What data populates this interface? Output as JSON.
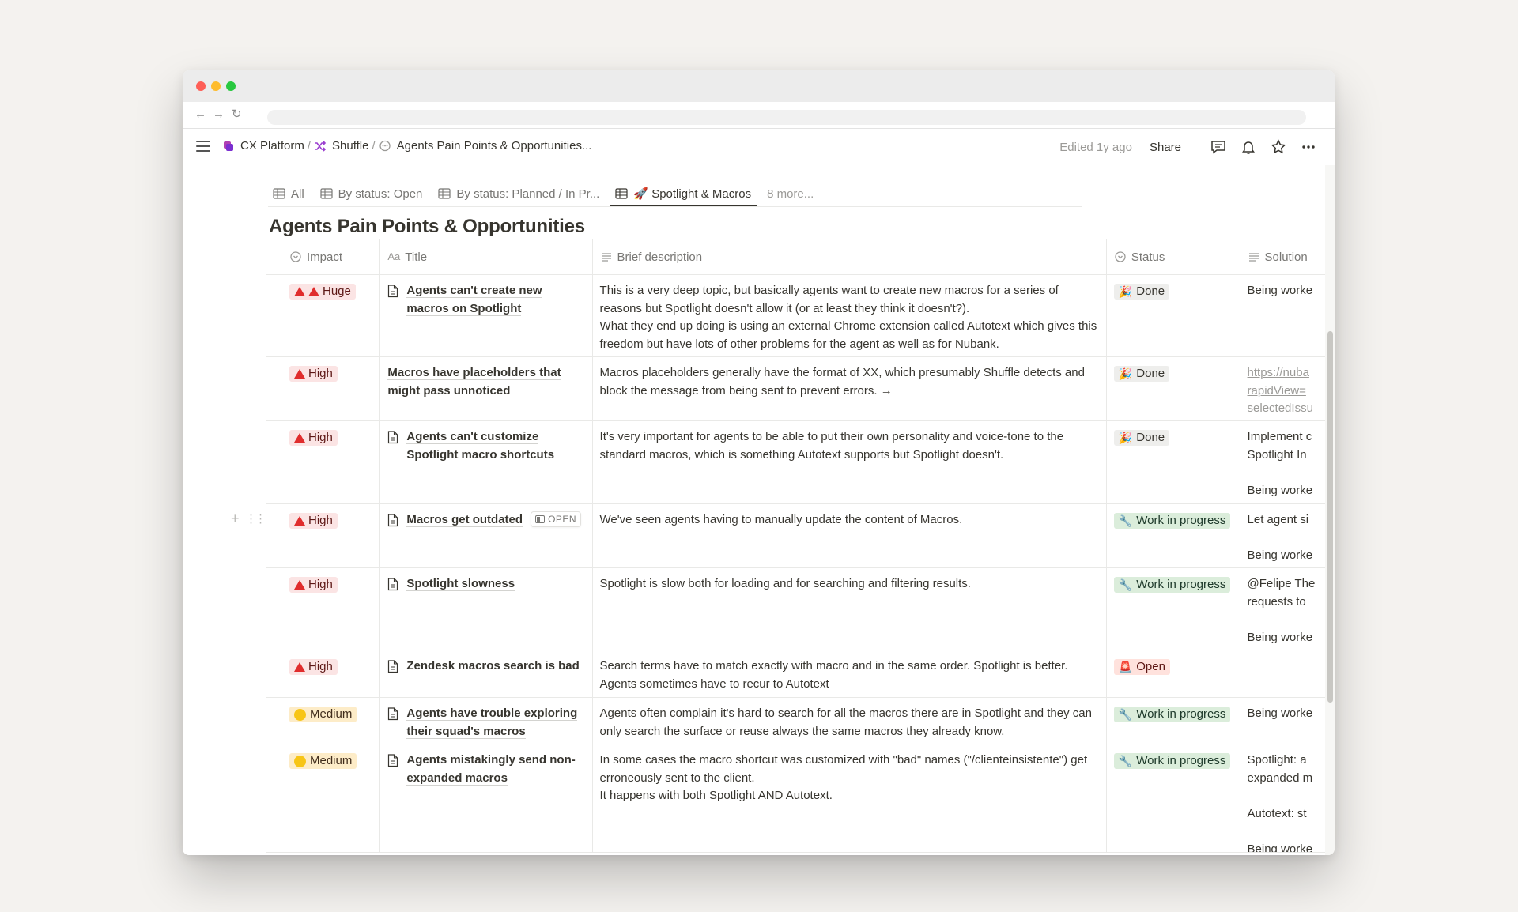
{
  "breadcrumb": {
    "items": [
      {
        "label": "CX Platform",
        "icon": "workspace-icon"
      },
      {
        "label": "Shuffle",
        "icon": "shuffle-icon"
      },
      {
        "label": "Agents Pain Points & Opportunities...",
        "icon": "comment-icon"
      }
    ],
    "separator": "/"
  },
  "topbar": {
    "edited": "Edited 1y ago",
    "share": "Share"
  },
  "tabs": [
    {
      "label": "All"
    },
    {
      "label": "By status: Open"
    },
    {
      "label": "By status: Planned / In Pr..."
    },
    {
      "label": "🚀 Spotlight & Macros",
      "active": true
    }
  ],
  "tabs_more": "8 more...",
  "page_title": "Agents Pain Points & Opportunities",
  "columns": {
    "impact": "Impact",
    "title_prefix": "Aa",
    "title": "Title",
    "description": "Brief description",
    "status": "Status",
    "solution": "Solution"
  },
  "open_label": "OPEN",
  "colors": {
    "red_triangle": "#e02d2d",
    "high_bg": "#fbe4e4",
    "medium_bg": "#fdecc8",
    "wip_bg": "#dbeddb",
    "open_bg": "#ffe2dd",
    "done_bg": "#eeeeec"
  },
  "rows": [
    {
      "impact": "Huge",
      "impact_level": "huge",
      "title": "Agents can't create new macros on Spotlight",
      "has_doc_icon": true,
      "description": "This is a very deep topic, but basically agents want to create new macros for a series of reasons but Spotlight doesn't allow it (or at least they think it doesn't?).\nWhat they end up doing is using an external Chrome extension called Autotext which gives this freedom but have lots of other problems for the agent as well as for Nubank.",
      "status": "Done",
      "status_emoji": "🎉",
      "status_level": "done",
      "solution": "Being worke"
    },
    {
      "impact": "High",
      "impact_level": "high",
      "title": "Macros have placeholders that might pass unnoticed",
      "has_doc_icon": false,
      "description": "Macros placeholders generally have the format of XX, which presumably Shuffle detects and block the message from being sent to prevent errors. →",
      "status": "Done",
      "status_emoji": "🎉",
      "status_level": "done",
      "solution": "https://nuba\nrapidView=\nselectedIssu",
      "solution_is_link": true
    },
    {
      "impact": "High",
      "impact_level": "high",
      "title": "Agents can't customize Spotlight macro shortcuts",
      "has_doc_icon": true,
      "description": "It's very important for agents to be able to put their own personality and voice-tone to the standard macros, which is something Autotext supports but Spotlight doesn't.",
      "status": "Done",
      "status_emoji": "🎉",
      "status_level": "done",
      "solution": "Implement c\nSpotlight In\n\nBeing worke"
    },
    {
      "impact": "High",
      "impact_level": "high",
      "title": "Macros get outdated",
      "has_doc_icon": true,
      "show_open": true,
      "description": "We've seen agents having to manually update the content of Macros.",
      "status": "Work in progress",
      "status_emoji": "🔧",
      "status_level": "wip",
      "solution": "Let agent si\n\nBeing worke"
    },
    {
      "impact": "High",
      "impact_level": "high",
      "title": "Spotlight slowness",
      "has_doc_icon": true,
      "description": "Spotlight is slow both for loading and for searching and filtering results.",
      "status": "Work in progress",
      "status_emoji": "🔧",
      "status_level": "wip",
      "solution": "@Felipe The\nrequests to\n\nBeing worke"
    },
    {
      "impact": "High",
      "impact_level": "high",
      "title": "Zendesk macros search is bad",
      "has_doc_icon": true,
      "description": "Search terms have to match exactly with macro and in the same order. Spotlight is better.\nAgents sometimes have to recur to Autotext",
      "status": "Open",
      "status_emoji": "🚨",
      "status_level": "open",
      "solution": ""
    },
    {
      "impact": "Medium",
      "impact_level": "medium",
      "title": "Agents have trouble exploring their squad's macros",
      "has_doc_icon": true,
      "description": "Agents often complain it's hard to search for all the macros there are in Spotlight and they can only search the surface or reuse always the same macros they already know.",
      "status": "Work in progress",
      "status_emoji": "🔧",
      "status_level": "wip",
      "solution": "Being worke"
    },
    {
      "impact": "Medium",
      "impact_level": "medium",
      "title": "Agents mistakingly send non-expanded macros",
      "has_doc_icon": true,
      "description": "In some cases the macro shortcut was customized with \"bad\" names (\"/clienteinsistente\") get erroneously sent to the client.\nIt happens with both Spotlight AND Autotext.",
      "status": "Work in progress",
      "status_emoji": "🔧",
      "status_level": "wip",
      "solution": "Spotlight: a\nexpanded m\n\nAutotext: st\n\nBeing worke"
    }
  ]
}
